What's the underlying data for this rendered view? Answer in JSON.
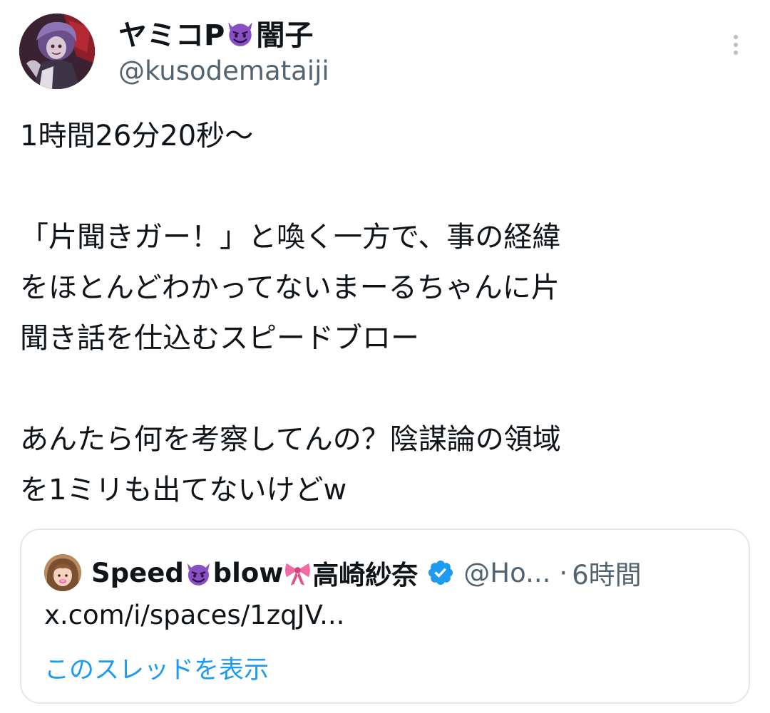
{
  "author": {
    "display_name_before_emoji": "ヤミコP",
    "display_name_emoji": "smiling-devil-emoji",
    "display_name_after_emoji": "闇子",
    "handle": "@kusodemataiji"
  },
  "tweet": {
    "lines": [
      "1時間26分20秒〜",
      "",
      "「片聞きガー！」と喚く一方で、事の経緯",
      "をほとんどわかってないまーるちゃんに片",
      "聞き話を仕込むスピードブロー",
      "",
      "あんたら何を考察してんの？陰謀論の領域",
      "を1ミリも出てないけどw"
    ]
  },
  "quote": {
    "name_part1": "Speed",
    "name_part2": "blow",
    "name_part3": "高崎紗奈",
    "name_emojis": [
      "smiling-devil-emoji",
      "ribbon-emoji"
    ],
    "handle": "@Ho...",
    "separator": "·",
    "time": "6時間",
    "link_text": "x.com/i/spaces/1zqJV...",
    "thread_link": "このスレッドを表示"
  },
  "colors": {
    "text_primary": "#0f1419",
    "text_secondary": "#536471",
    "link_blue": "#1d9bf0",
    "devil_purple": "#8a4fc4",
    "ribbon_pink": "#f06ba8",
    "border": "#e4e8eb"
  },
  "icons": [
    "more-vertical-icon",
    "verified-badge-icon"
  ]
}
